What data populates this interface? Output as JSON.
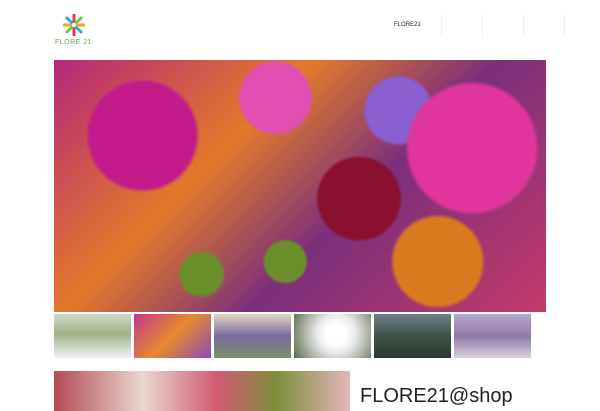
{
  "header": {
    "logo_text": "FLORE 21",
    "nav": [
      {
        "label": "FLORE21"
      },
      {
        "label": ""
      },
      {
        "label": ""
      },
      {
        "label": ""
      },
      {
        "label": ""
      }
    ]
  },
  "hero": {
    "thumbnails": [
      "thumbnail-1",
      "thumbnail-2",
      "thumbnail-3",
      "thumbnail-4",
      "thumbnail-5",
      "thumbnail-6"
    ]
  },
  "shop": {
    "heading": "FLORE21@shop"
  },
  "colors": {
    "brand_green": "#6aa84f",
    "text": "#222222"
  }
}
